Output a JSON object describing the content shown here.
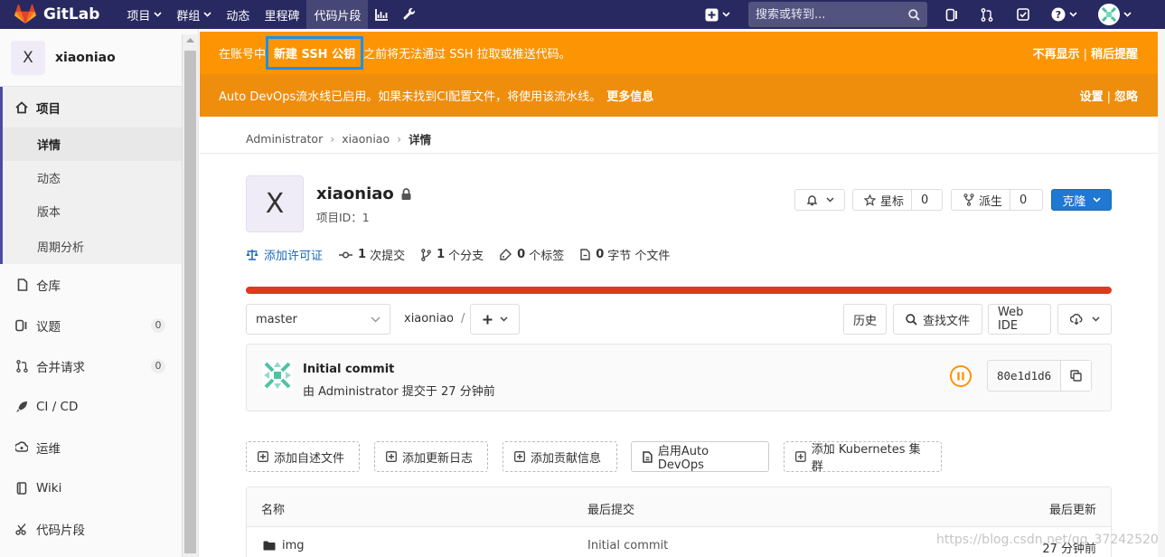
{
  "colors": {
    "navbar": "#292961",
    "banner_ssh": "#fc9403",
    "banner_devops": "#ef8d0d",
    "primary": "#1f78d1",
    "progress_red": "#db3b21",
    "highlight_box": "#1e90e6"
  },
  "navbar": {
    "brand": "GitLab",
    "items": [
      {
        "label": "项目",
        "has_caret": true
      },
      {
        "label": "群组",
        "has_caret": true
      },
      {
        "label": "动态"
      },
      {
        "label": "里程碑"
      },
      {
        "label": "代码片段",
        "active": true
      }
    ],
    "search_placeholder": "搜索或转到...",
    "right_icons": [
      "plus-icon",
      "issues-icon",
      "merge-request-icon",
      "todo-icon",
      "help-icon",
      "user-avatar"
    ]
  },
  "sidebar": {
    "project_initial": "X",
    "project_name": "xiaoniao",
    "sections": [
      {
        "label": "项目",
        "icon": "home-icon",
        "active": true,
        "subitems": [
          {
            "label": "详情",
            "active": true
          },
          {
            "label": "动态"
          },
          {
            "label": "版本"
          },
          {
            "label": "周期分析"
          }
        ]
      },
      {
        "label": "仓库",
        "icon": "repository-icon"
      },
      {
        "label": "议题",
        "icon": "issues-icon",
        "count": "0"
      },
      {
        "label": "合并请求",
        "icon": "merge-request-icon",
        "count": "0"
      },
      {
        "label": "CI / CD",
        "icon": "rocket-icon"
      },
      {
        "label": "运维",
        "icon": "operations-icon"
      },
      {
        "label": "Wiki",
        "icon": "book-icon"
      },
      {
        "label": "代码片段",
        "icon": "snippet-icon"
      }
    ]
  },
  "banners": {
    "ssh": {
      "prefix": "在账号中",
      "link": "新建 SSH 公钥",
      "suffix": "之前将无法通过 SSH 拉取或推送代码。",
      "dismiss": "不再显示",
      "remind": "稍后提醒"
    },
    "devops": {
      "text": "Auto DevOps流水线已启用。如果未找到CI配置文件，将使用该流水线。",
      "more": "更多信息",
      "settings": "设置",
      "ignore": "忽略"
    }
  },
  "breadcrumb": {
    "items": [
      "Administrator",
      "xiaoniao",
      "详情"
    ]
  },
  "project": {
    "initial": "X",
    "name": "xiaoniao",
    "id_text": "项目ID：1",
    "star_label": "星标",
    "star_count": "0",
    "fork_label": "派生",
    "fork_count": "0",
    "clone_label": "克隆"
  },
  "stats": {
    "license": "添加许可证",
    "commits_count": "1",
    "commits_label": "次提交",
    "branches_count": "1",
    "branches_label": "个分支",
    "tags_count": "0",
    "tags_label": "个标签",
    "storage_count": "0",
    "storage_label": "字节 个文件"
  },
  "toolbar": {
    "branch": "master",
    "path": "xiaoniao",
    "path_sep": "/",
    "history": "历史",
    "find_file": "查找文件",
    "web_ide": "Web IDE"
  },
  "commit": {
    "title": "Initial commit",
    "meta": "由 Administrator 提交于 27 分钟前",
    "sha": "80e1d1d6"
  },
  "quick_actions": [
    {
      "label": "添加自述文件"
    },
    {
      "label": "添加更新日志"
    },
    {
      "label": "添加贡献信息"
    },
    {
      "label": "启用Auto DevOps"
    },
    {
      "label": "添加 Kubernetes 集群"
    }
  ],
  "file_table": {
    "headers": [
      "名称",
      "最后提交",
      "最后更新"
    ],
    "rows": [
      {
        "name": "img",
        "commit": "Initial commit",
        "updated": "27 分钟前"
      }
    ]
  },
  "watermark": "https://blog.csdn.net/qq_37242520"
}
